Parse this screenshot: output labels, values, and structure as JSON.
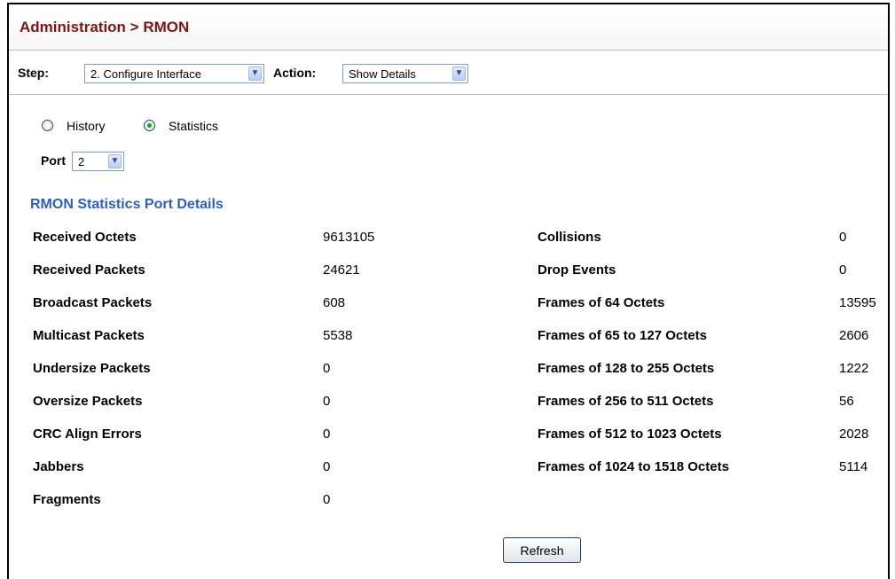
{
  "breadcrumb": "Administration > RMON",
  "step": {
    "label": "Step:",
    "value": "2. Configure Interface"
  },
  "action": {
    "label": "Action:",
    "value": "Show Details"
  },
  "view_options": [
    {
      "label": "History",
      "selected": false
    },
    {
      "label": "Statistics",
      "selected": true
    }
  ],
  "port": {
    "label": "Port",
    "value": "2"
  },
  "section_title": "RMON Statistics Port Details",
  "left_stats": [
    {
      "label": "Received Octets",
      "value": "9613105"
    },
    {
      "label": "Received Packets",
      "value": "24621"
    },
    {
      "label": "Broadcast Packets",
      "value": "608"
    },
    {
      "label": "Multicast Packets",
      "value": "5538"
    },
    {
      "label": "Undersize Packets",
      "value": "0"
    },
    {
      "label": "Oversize Packets",
      "value": "0"
    },
    {
      "label": "CRC Align Errors",
      "value": "0"
    },
    {
      "label": "Jabbers",
      "value": "0"
    },
    {
      "label": "Fragments",
      "value": "0"
    }
  ],
  "right_stats": [
    {
      "label": "Collisions",
      "value": "0"
    },
    {
      "label": "Drop Events",
      "value": "0"
    },
    {
      "label": "Frames of 64 Octets",
      "value": "13595"
    },
    {
      "label": "Frames of 65 to 127 Octets",
      "value": "2606"
    },
    {
      "label": "Frames of 128 to 255 Octets",
      "value": "1222"
    },
    {
      "label": "Frames of 256 to 511 Octets",
      "value": "56"
    },
    {
      "label": "Frames of 512 to 1023 Octets",
      "value": "2028"
    },
    {
      "label": "Frames of 1024 to 1518 Octets",
      "value": "5114"
    }
  ],
  "refresh_label": "Refresh",
  "colors": {
    "title": "#7a1616",
    "section": "#2e5fb5",
    "border": "#000000"
  },
  "icons": {
    "dropdown": "chevron-down-icon",
    "radio": "radio-icon"
  }
}
